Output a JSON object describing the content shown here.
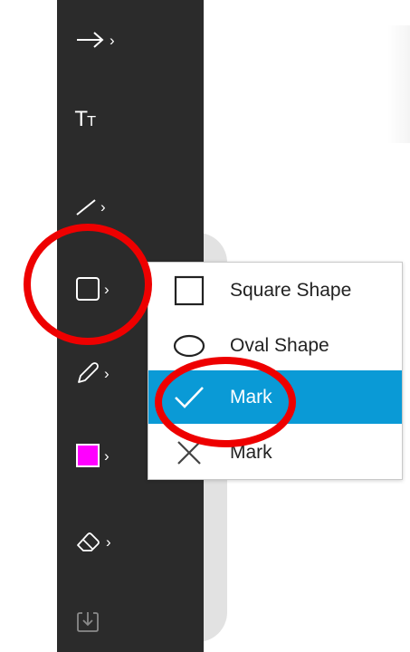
{
  "toolbar": {
    "tools": [
      {
        "name": "arrow-tool",
        "icon": "arrow-right-icon",
        "chevron": "›"
      },
      {
        "name": "text-tool",
        "icon": "text-icon",
        "glyph_big": "T",
        "glyph_small": "T"
      },
      {
        "name": "line-tool",
        "icon": "line-icon",
        "chevron": "›"
      },
      {
        "name": "shape-tool",
        "icon": "square-shape-icon",
        "chevron": "›"
      },
      {
        "name": "pen-tool",
        "icon": "pencil-icon",
        "chevron": "›"
      },
      {
        "name": "color-tool",
        "icon": "color-swatch-icon",
        "chevron": "›",
        "color": "#ff00ff"
      },
      {
        "name": "eraser-tool",
        "icon": "eraser-icon",
        "chevron": "›"
      },
      {
        "name": "save-tool",
        "icon": "download-icon"
      }
    ]
  },
  "shape_menu": {
    "items": [
      {
        "label": "Square Shape",
        "icon": "square-icon",
        "selected": false
      },
      {
        "label": "Oval Shape",
        "icon": "oval-icon",
        "selected": false
      },
      {
        "label": "Mark",
        "icon": "checkmark-icon",
        "selected": true
      },
      {
        "label": "Mark",
        "icon": "cross-icon",
        "selected": false
      }
    ]
  },
  "zoom_panel": {
    "items": [
      "zoom-in-icon",
      "zoom-out-icon",
      "fit-screen-icon"
    ]
  },
  "colors": {
    "toolbar_bg": "#2b2b2b",
    "selection": "#0a9ad6",
    "annotation": "#ee0000",
    "current_color": "#ff00ff"
  }
}
